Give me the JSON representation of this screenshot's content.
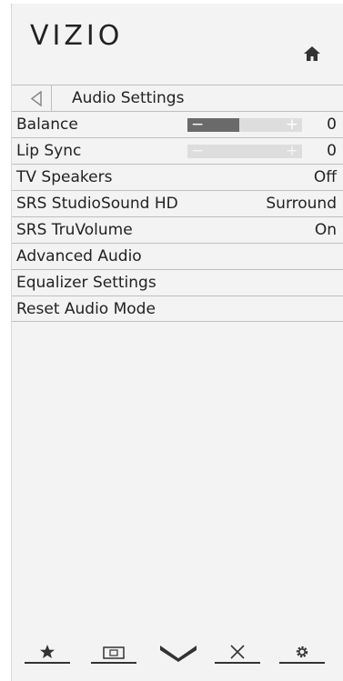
{
  "brand": {
    "logo_text": "VIZIO",
    "accent": "#6a6a6a"
  },
  "header": {
    "title": "Audio Settings"
  },
  "rows": [
    {
      "label": "Balance",
      "value": "0",
      "slider_level": 0.45,
      "slider_active": true
    },
    {
      "label": "Lip Sync",
      "value": "0",
      "slider_level": 0.0,
      "slider_active": false
    },
    {
      "label": "TV Speakers",
      "value": "Off"
    },
    {
      "label": "SRS StudioSound HD",
      "value": "Surround"
    },
    {
      "label": "SRS TruVolume",
      "value": "On"
    },
    {
      "label": "Advanced Audio",
      "value": ""
    },
    {
      "label": "Equalizer Settings",
      "value": ""
    },
    {
      "label": "Reset Audio Mode",
      "value": ""
    }
  ],
  "slider_symbols": {
    "minus": "−",
    "plus": "+"
  },
  "bottom_bar": {
    "icons": [
      "star-icon",
      "input-icon",
      "vizio-v-icon",
      "close-icon",
      "gear-icon"
    ]
  }
}
